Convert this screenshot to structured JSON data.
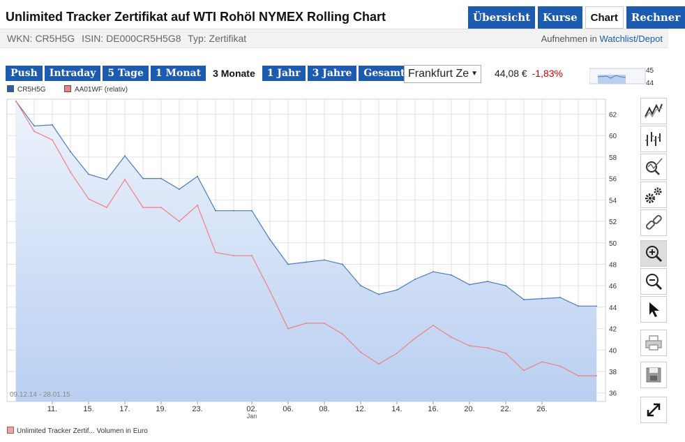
{
  "header": {
    "title": "Unlimited Tracker Zertifikat auf WTI Rohöl NYMEX Rolling Chart",
    "tabs": [
      "Übersicht",
      "Kurse",
      "Chart",
      "Rechner"
    ],
    "active_tab": "Chart"
  },
  "meta": {
    "wkn": "WKN: CR5H5G",
    "isin": "ISIN: DE000CR5H5G8",
    "typ": "Typ: Zertifikat",
    "watchlist_prefix": "Aufnehmen in",
    "watchlist_link": "Watchlist/Depot"
  },
  "ranges": [
    "Push",
    "Intraday",
    "5 Tage",
    "1 Monat",
    "3 Monate",
    "1 Jahr",
    "3 Jahre",
    "Gesamt"
  ],
  "active_range": "3 Monate",
  "exchange": "Frankfurt Ze",
  "quote": {
    "price": "44,08 €",
    "change": "-1,83%"
  },
  "spark_labels": [
    "45",
    "44"
  ],
  "legend": {
    "series1": "CR5H5G",
    "series2": "AA01WF (relativ)"
  },
  "date_range": "09.12.14 - 28.01.15",
  "volume_legend": "Unlimited Tracker Zertif... Volumen in Euro",
  "colors": {
    "blue": "#4a7bc0",
    "red": "#f08080",
    "nav": "#1c5bb0",
    "down": "#cc0000"
  },
  "toolbar_icons": [
    "line-chart-icon",
    "ohlc-chart-icon",
    "indicator-icon",
    "settings-icon",
    "link-icon",
    "zoom-in-icon",
    "zoom-out-icon",
    "pointer-icon",
    "print-icon",
    "save-icon",
    "fullscreen-icon"
  ],
  "chart_data": {
    "type": "line",
    "x": [
      "09.12.",
      "10.12.",
      "11.12.",
      "12.12.",
      "15.12.",
      "16.12.",
      "17.12.",
      "18.12.",
      "19.12.",
      "22.12.",
      "23.12.",
      "29.12.",
      "30.12.",
      "31.12.",
      "02.01.",
      "05.01.",
      "06.01.",
      "07.01.",
      "08.01.",
      "09.01.",
      "12.01.",
      "13.01.",
      "14.01.",
      "15.01.",
      "16.01.",
      "19.01.",
      "20.01.",
      "21.01.",
      "22.01.",
      "23.01.",
      "26.01.",
      "27.01.",
      "28.01."
    ],
    "x_tick_labels": [
      "11.",
      "15.",
      "17.",
      "19.",
      "23.",
      "02.",
      "06.",
      "08.",
      "12.",
      "14.",
      "16.",
      "20.",
      "22.",
      "26."
    ],
    "x_tick_index": [
      2,
      4,
      6,
      8,
      10,
      13,
      15,
      17,
      19,
      21,
      23,
      25,
      27,
      29
    ],
    "x_month_label": "Jan",
    "y_ticks": [
      36,
      38,
      40,
      42,
      44,
      46,
      48,
      50,
      52,
      54,
      56,
      58,
      60,
      62
    ],
    "ylim": [
      35.2,
      63.4
    ],
    "grid": true,
    "series": [
      {
        "name": "CR5H5G",
        "values": [
          63.2,
          60.9,
          61.0,
          58.5,
          56.4,
          55.9,
          58.1,
          56.0,
          56.0,
          55.0,
          56.2,
          53.0,
          53.0,
          53.0,
          50.3,
          48.0,
          48.2,
          48.4,
          48.0,
          46.0,
          45.2,
          45.6,
          46.6,
          47.3,
          47.0,
          46.1,
          46.4,
          46.0,
          44.7,
          44.8,
          44.9,
          44.1,
          44.1
        ]
      },
      {
        "name": "AA01WF (relativ)",
        "values": [
          63.2,
          60.4,
          59.6,
          56.6,
          54.1,
          53.3,
          55.9,
          53.3,
          53.3,
          52.0,
          53.5,
          49.1,
          48.8,
          48.8,
          45.5,
          42.0,
          42.5,
          42.5,
          41.5,
          39.8,
          38.7,
          39.7,
          41.1,
          42.3,
          41.2,
          40.4,
          40.2,
          39.7,
          38.1,
          38.9,
          38.5,
          37.6,
          37.6
        ]
      }
    ]
  }
}
